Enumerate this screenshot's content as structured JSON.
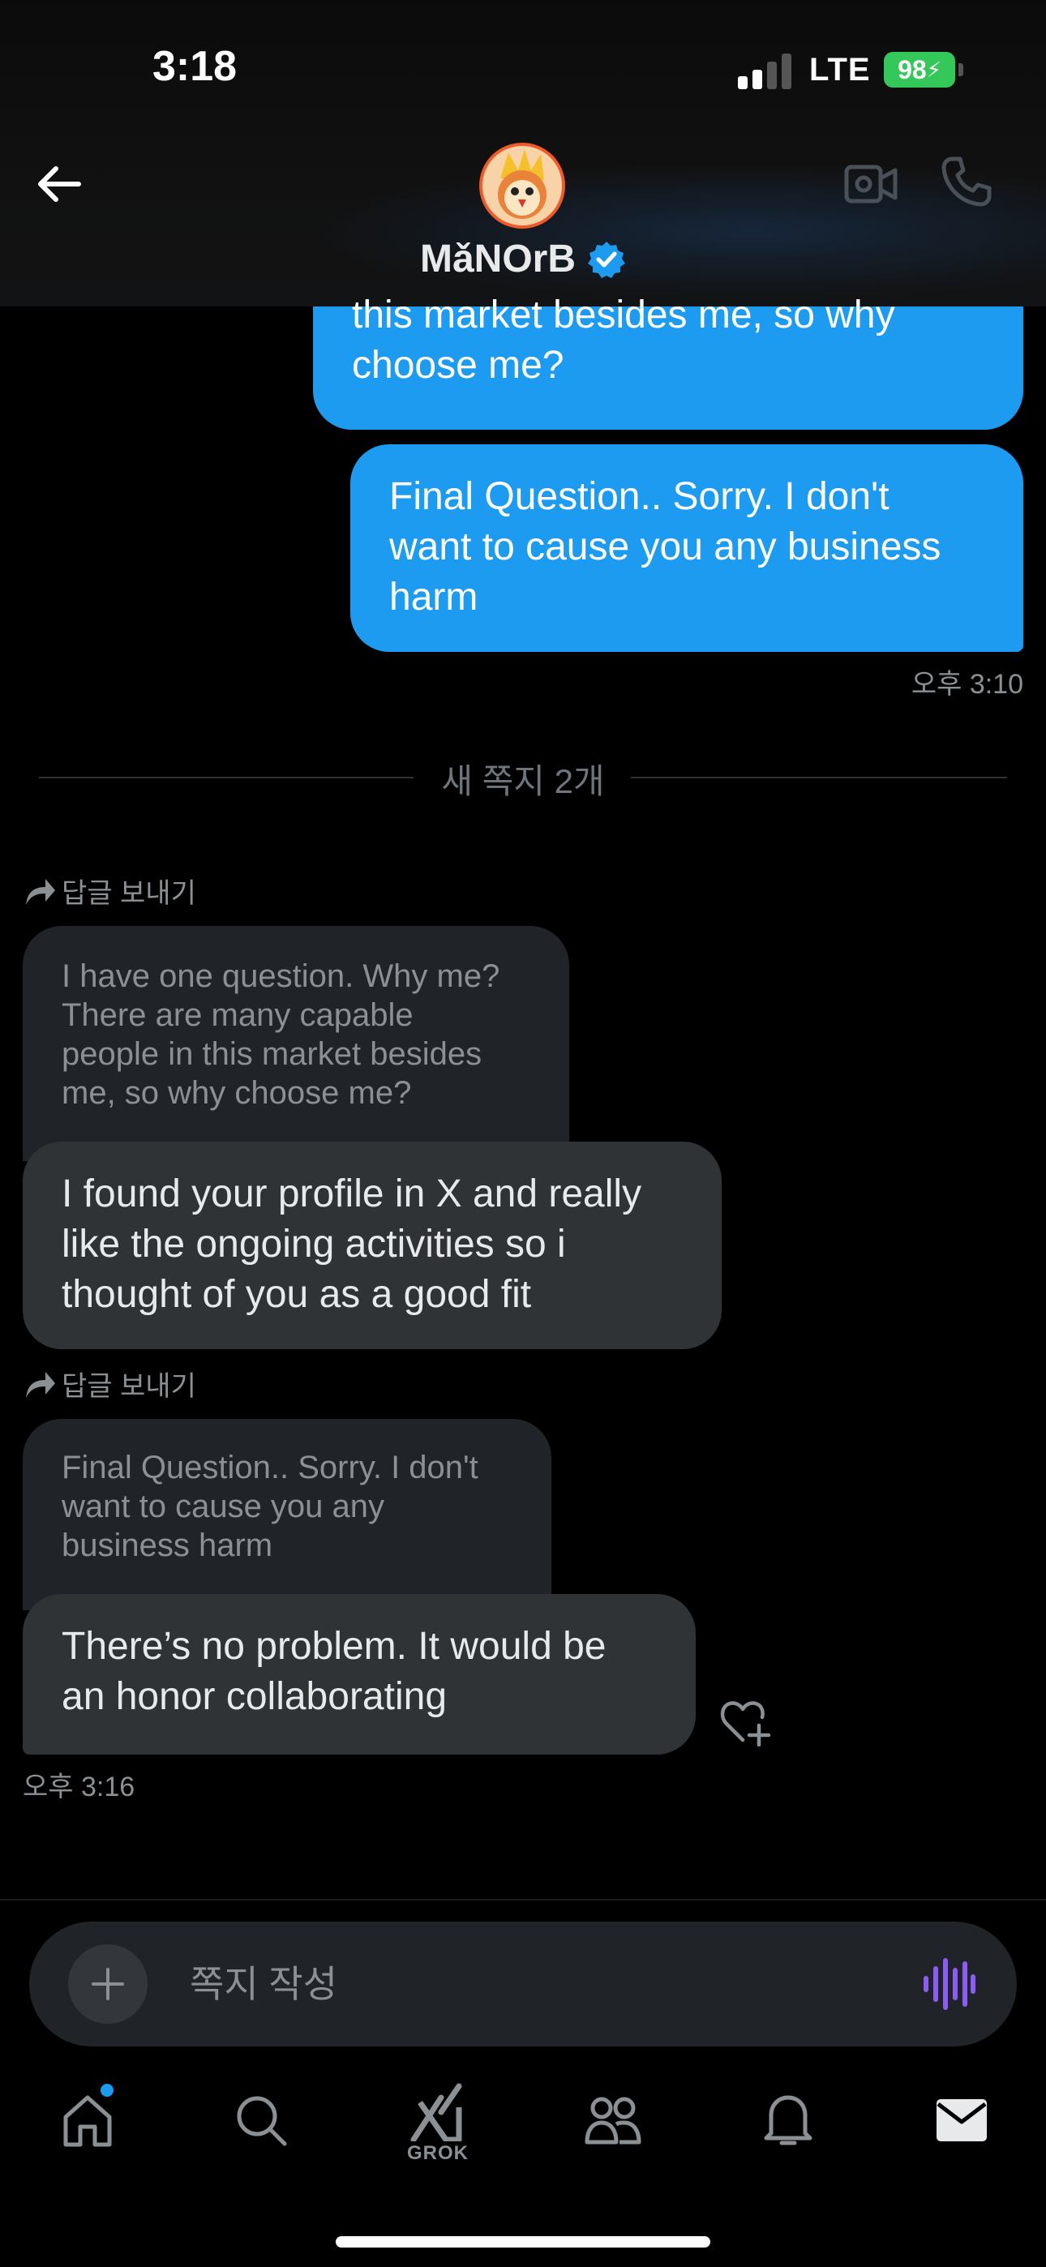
{
  "status_bar": {
    "time": "3:18",
    "network": "LTE",
    "battery": "98"
  },
  "header": {
    "contact_name": "MǎNOrB",
    "verified": true
  },
  "messages": {
    "out_partial": {
      "lines": [
        "this market besides me, so why",
        "choose me?"
      ]
    },
    "out_final": {
      "lines": [
        "Final Question.. Sorry. I don't",
        "want to cause you any business",
        "harm"
      ],
      "time": "오후 3:10"
    },
    "divider_label": "새 쪽지 2개",
    "reply_1": {
      "reply_label": "답글 보내기",
      "quoted_lines": [
        "I have one question. Why me?",
        "There are many capable",
        "people in this market besides",
        "me, so why choose me?"
      ],
      "lines": [
        "I found your profile in X and really",
        "like the ongoing activities so i",
        "thought of you as a good fit"
      ]
    },
    "reply_2": {
      "reply_label": "답글 보내기",
      "quoted_lines": [
        "Final Question.. Sorry. I don't",
        "want to cause you any",
        "business harm"
      ],
      "lines": [
        "There’s no problem.  It would be",
        "an honor collaborating"
      ],
      "time": "오후 3:16"
    }
  },
  "composer": {
    "placeholder": "쪽지 작성"
  },
  "nav": {
    "grok_label": "GROK"
  },
  "colors": {
    "accent": "#1d9bf0",
    "incoming_bubble": "#2f3336",
    "quoted_bubble": "#202327",
    "battery": "#34c759",
    "voice_icon": "#8c5cf6"
  },
  "icons": [
    "back-arrow-icon",
    "video-call-icon",
    "phone-icon",
    "verified-badge-icon",
    "reply-arrow-icon",
    "heart-plus-icon",
    "plus-icon",
    "voice-wave-icon",
    "home-icon",
    "search-icon",
    "grok-icon",
    "communities-icon",
    "bell-icon",
    "mail-icon"
  ]
}
